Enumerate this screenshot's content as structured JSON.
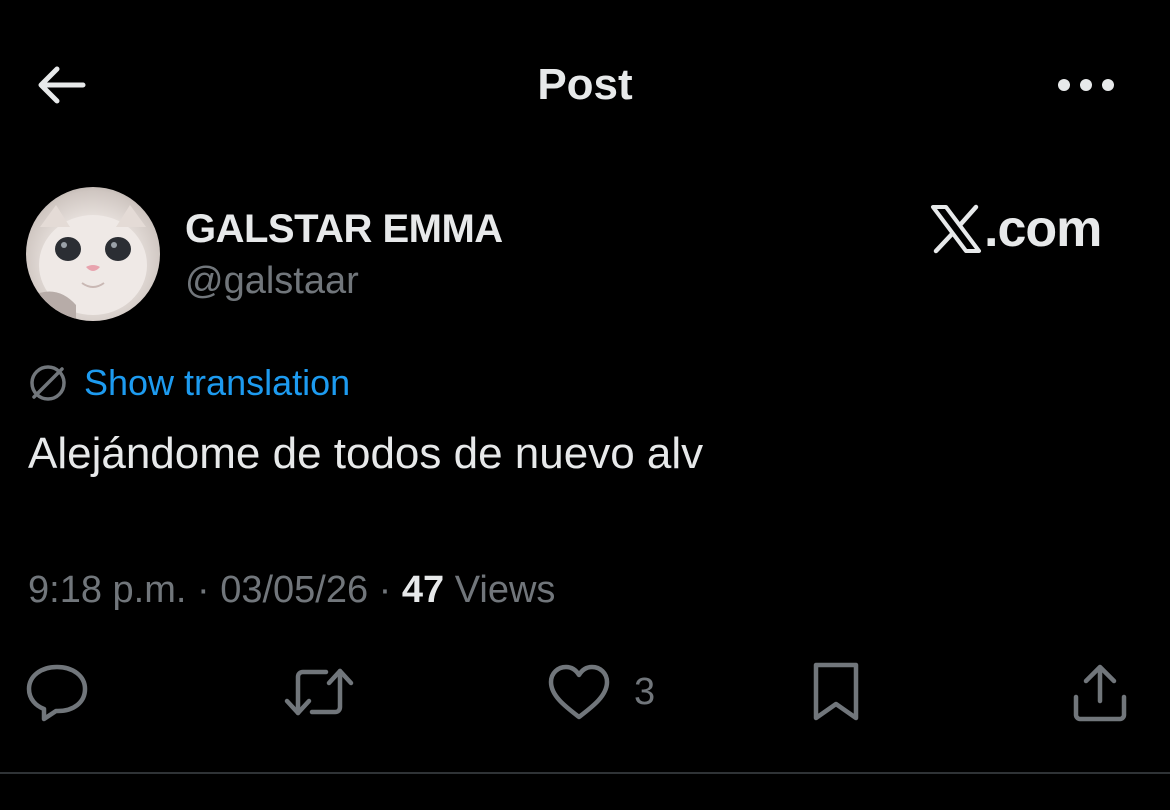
{
  "header": {
    "title": "Post",
    "back_icon": "arrow-left-icon",
    "more_icon": "ellipsis-icon"
  },
  "author": {
    "display_name": "GALSTAR EMMA",
    "handle": "@galstaar",
    "avatar_icon": "kitten-avatar"
  },
  "watermark": {
    "text": ".com",
    "icon": "x-logo-icon"
  },
  "translation": {
    "label": "Show translation",
    "icon": "globe-slash-icon"
  },
  "post": {
    "text": "Alejándome de todos de nuevo alv"
  },
  "meta": {
    "time": "9:18 p.m.",
    "separator": " · ",
    "date": "03/05/26",
    "views_count": "47",
    "views_label": " Views"
  },
  "actions": {
    "reply_icon": "reply-icon",
    "repost_icon": "repost-icon",
    "like_icon": "heart-icon",
    "like_count": "3",
    "bookmark_icon": "bookmark-icon",
    "share_icon": "share-icon"
  },
  "colors": {
    "background": "#000000",
    "text_primary": "#e7e9ea",
    "text_secondary": "#71767b",
    "accent": "#1d9bf0",
    "divider": "#2f3336"
  }
}
